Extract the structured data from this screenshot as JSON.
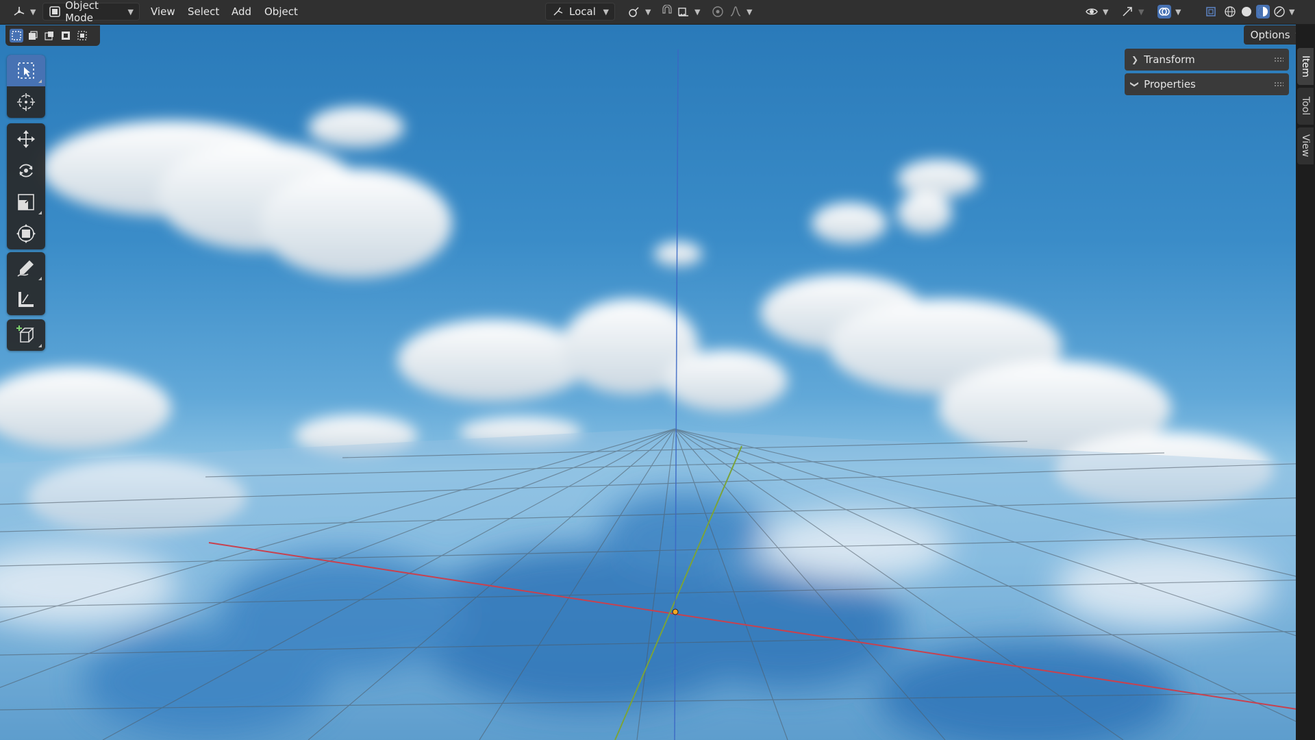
{
  "header": {
    "editor_type_icon": "3d-viewport-icon",
    "mode_label": "Object Mode",
    "menus": [
      "View",
      "Select",
      "Add",
      "Object"
    ],
    "transform_orientation": "Local",
    "options_label": "Options"
  },
  "select_modes": [
    "select-new-icon",
    "select-extend-icon",
    "select-subtract-icon",
    "select-invert-icon",
    "select-intersect-icon"
  ],
  "tools": [
    {
      "name": "select-box-icon",
      "active": true
    },
    {
      "name": "cursor-icon",
      "active": false
    },
    {
      "name": "move-icon",
      "active": false
    },
    {
      "name": "rotate-icon",
      "active": false
    },
    {
      "name": "scale-icon",
      "active": false
    },
    {
      "name": "transform-icon",
      "active": false
    },
    {
      "name": "annotate-icon",
      "active": false
    },
    {
      "name": "measure-icon",
      "active": false
    },
    {
      "name": "add-cube-icon",
      "active": false
    }
  ],
  "sidebar": {
    "panels": [
      {
        "label": "Transform",
        "expanded": false
      },
      {
        "label": "Properties",
        "expanded": true
      }
    ],
    "tabs": [
      "Item",
      "Tool",
      "View"
    ],
    "active_tab": "Item"
  },
  "colors": {
    "accent": "#4772b3",
    "header_bg": "#303030",
    "x_axis": "#c8414e",
    "y_axis": "#7aa33a",
    "z_axis": "#3b67c4",
    "origin": "#f5a623"
  }
}
